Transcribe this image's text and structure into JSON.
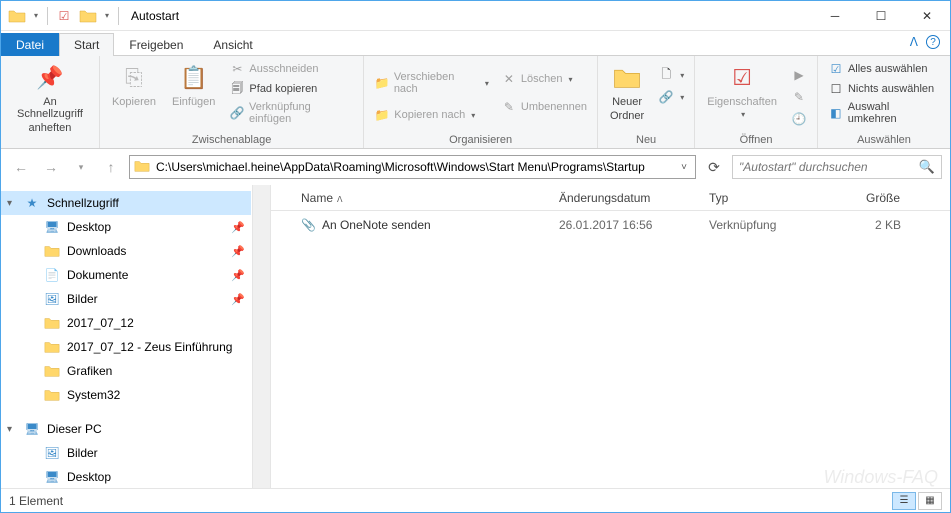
{
  "window": {
    "title": "Autostart"
  },
  "tabs": {
    "file": "Datei",
    "start": "Start",
    "share": "Freigeben",
    "view": "Ansicht"
  },
  "ribbon": {
    "pin": {
      "line1": "An Schnellzugriff",
      "line2": "anheften"
    },
    "clipboard": {
      "copy": "Kopieren",
      "paste": "Einfügen",
      "cut": "Ausschneiden",
      "copypath": "Pfad kopieren",
      "pasteshortcut": "Verknüpfung einfügen",
      "label": "Zwischenablage"
    },
    "organize": {
      "moveto": "Verschieben nach",
      "copyto": "Kopieren nach",
      "delete": "Löschen",
      "rename": "Umbenennen",
      "label": "Organisieren"
    },
    "new": {
      "folder_l1": "Neuer",
      "folder_l2": "Ordner",
      "label": "Neu"
    },
    "open": {
      "props": "Eigenschaften",
      "label": "Öffnen"
    },
    "select": {
      "all": "Alles auswählen",
      "none": "Nichts auswählen",
      "invert": "Auswahl umkehren",
      "label": "Auswählen"
    }
  },
  "address": {
    "path": "C:\\Users\\michael.heine\\AppData\\Roaming\\Microsoft\\Windows\\Start Menu\\Programs\\Startup",
    "search_placeholder": "\"Autostart\" durchsuchen"
  },
  "sidebar": {
    "quickaccess": "Schnellzugriff",
    "items": [
      {
        "label": "Desktop",
        "icon": "desktop",
        "pinned": true
      },
      {
        "label": "Downloads",
        "icon": "folder",
        "pinned": true
      },
      {
        "label": "Dokumente",
        "icon": "doc",
        "pinned": true
      },
      {
        "label": "Bilder",
        "icon": "pic",
        "pinned": true
      },
      {
        "label": "2017_07_12",
        "icon": "folder",
        "pinned": false
      },
      {
        "label": "2017_07_12 - Zeus Einführung",
        "icon": "folder",
        "pinned": false
      },
      {
        "label": "Grafiken",
        "icon": "folder",
        "pinned": false
      },
      {
        "label": "System32",
        "icon": "folder",
        "pinned": false
      }
    ],
    "thispc": "Dieser PC",
    "pc_items": [
      {
        "label": "Bilder",
        "icon": "pic"
      },
      {
        "label": "Desktop",
        "icon": "desktop"
      }
    ]
  },
  "columns": {
    "name": "Name",
    "date": "Änderungsdatum",
    "type": "Typ",
    "size": "Größe"
  },
  "files": [
    {
      "name": "An OneNote senden",
      "date": "26.01.2017 16:56",
      "type": "Verknüpfung",
      "size": "2 KB"
    }
  ],
  "status": {
    "count": "1 Element"
  },
  "watermark": "Windows-FAQ"
}
